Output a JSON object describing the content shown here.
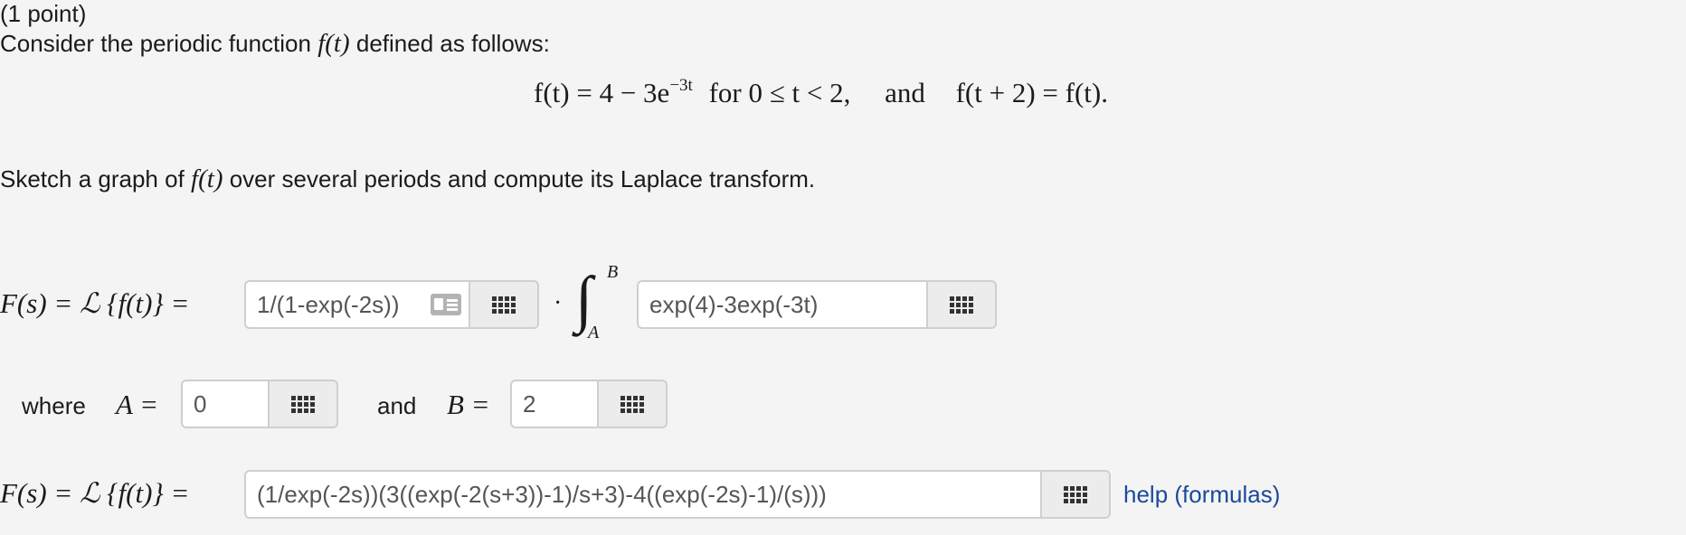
{
  "problem": {
    "points": "(1 point)",
    "intro_before": "Consider the periodic function",
    "intro_after": "defined as follows:",
    "sketch_before": "Sketch a graph of",
    "sketch_after": "over several periods and compute its Laplace transform."
  },
  "definition": {
    "lhs": "f(t) = 4 − 3e",
    "exponent": "−3t",
    "for_text": "for 0 ≤ t < 2,",
    "and_text": "and",
    "periodic": "f(t + 2) = f(t)."
  },
  "func_label": "f(t)",
  "laplace_label": "F(s) = ℒ {f(t)} =",
  "integral": {
    "upper": "B",
    "lower": "A",
    "dot": "·"
  },
  "answers": {
    "factor_value": "1/(1-exp(-2s))",
    "integrand_value": "exp(4)-3exp(-3t)",
    "A_value": "0",
    "B_value": "2",
    "final_value": "(1/exp(-2s))(3((exp(-2(s+3))-1)/s+3)-4((exp(-2s)-1)/(s)))"
  },
  "where_row": {
    "where": "where",
    "A_label": "A =",
    "and": "and",
    "B_label": "B ="
  },
  "help_link": "help (formulas)",
  "icons": {
    "keyboard": "keyboard-grid-icon",
    "card": "preview-card-icon"
  }
}
